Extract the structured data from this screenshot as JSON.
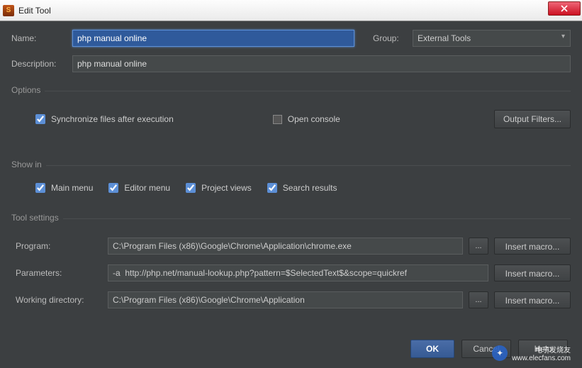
{
  "window": {
    "title": "Edit Tool",
    "close": "Close"
  },
  "form": {
    "name_label": "Name:",
    "name_value": "php manual online",
    "group_label": "Group:",
    "group_value": "External Tools",
    "description_label": "Description:",
    "description_value": "php manual online"
  },
  "options": {
    "section_title": "Options",
    "sync_label": "Synchronize files after execution",
    "sync_checked": true,
    "open_console_label": "Open console",
    "open_console_checked": false,
    "output_filters_label": "Output Filters..."
  },
  "show_in": {
    "section_title": "Show in",
    "main_menu": "Main menu",
    "editor_menu": "Editor menu",
    "project_views": "Project views",
    "search_results": "Search results"
  },
  "tool_settings": {
    "section_title": "Tool settings",
    "program_label": "Program:",
    "program_value": "C:\\Program Files (x86)\\Google\\Chrome\\Application\\chrome.exe",
    "parameters_label": "Parameters:",
    "parameters_value": "-a  http://php.net/manual-lookup.php?pattern=$SelectedText$&scope=quickref",
    "working_dir_label": "Working directory:",
    "working_dir_value": "C:\\Program Files (x86)\\Google\\Chrome\\Application",
    "browse_label": "...",
    "insert_macro_label": "Insert macro..."
  },
  "buttons": {
    "ok": "OK",
    "cancel": "Cancel",
    "help": "Help"
  },
  "watermark": {
    "line1": "电子发烧友",
    "line2": "www.elecfans.com"
  }
}
